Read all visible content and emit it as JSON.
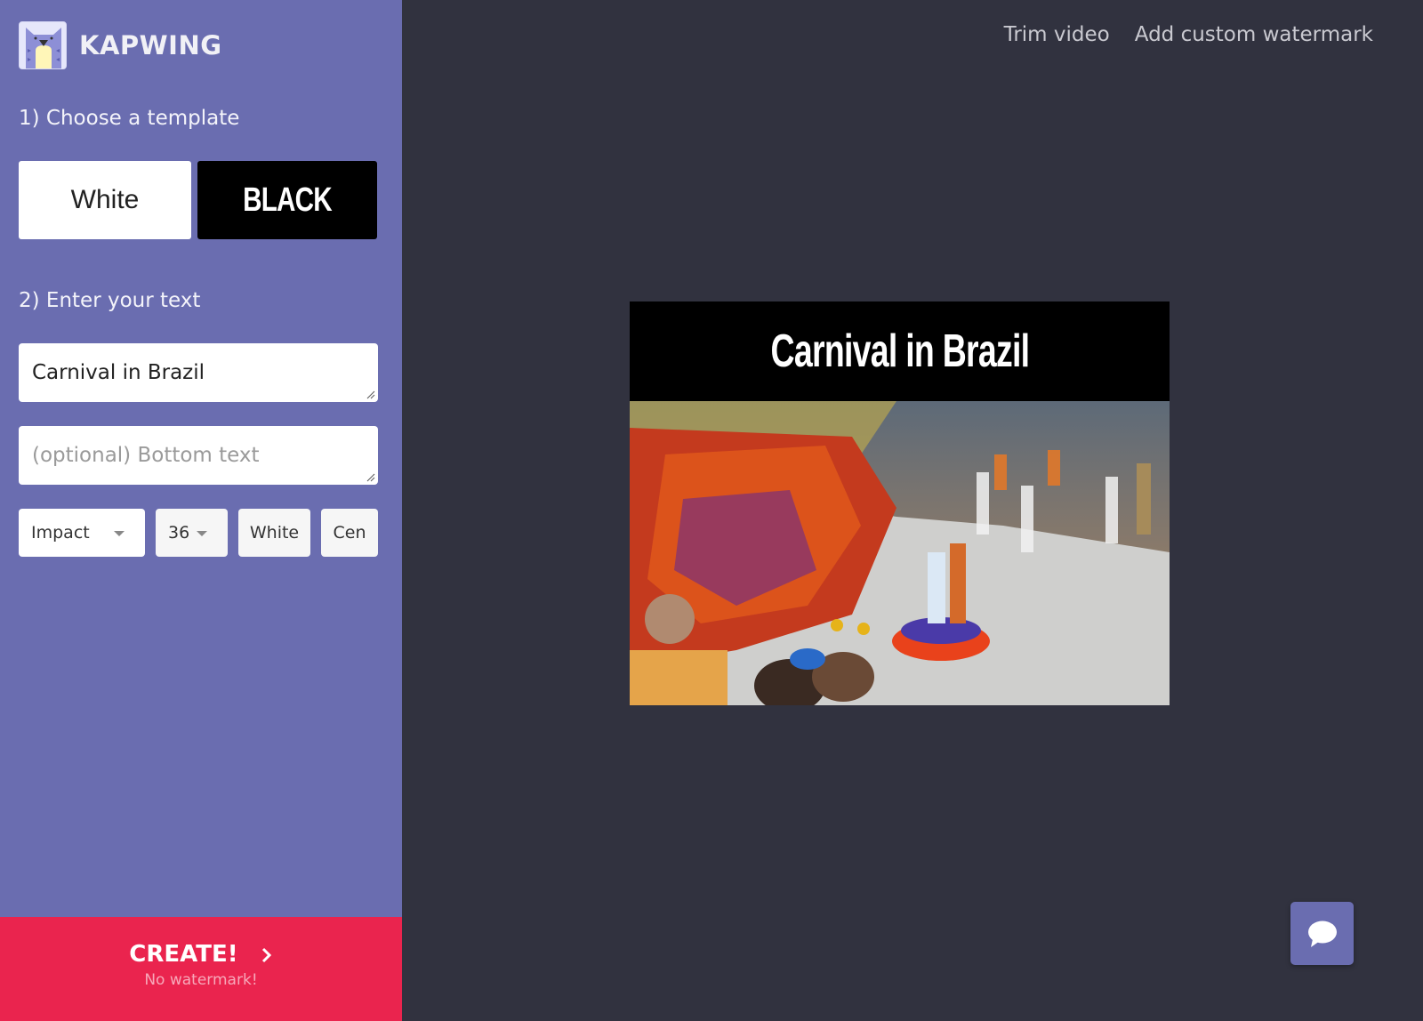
{
  "brand": {
    "name": "KAPWING",
    "logo_icon": "cat-logo-icon"
  },
  "steps": {
    "template_title": "1) Choose a template",
    "text_title": "2) Enter your text"
  },
  "templates": [
    {
      "label": "White",
      "background": "#ffffff",
      "text_color": "#222222"
    },
    {
      "label": "BLACK",
      "background": "#000000",
      "text_color": "#ffffff",
      "selected": true
    }
  ],
  "text_inputs": {
    "top_text": {
      "value": "Carnival in Brazil",
      "placeholder": ""
    },
    "bottom_text": {
      "value": "",
      "placeholder": "(optional) Bottom text"
    }
  },
  "controls": {
    "font": "Impact",
    "size": "36",
    "color": "White",
    "align": "Cen"
  },
  "create_button": {
    "label": "CREATE!",
    "sublabel": "No watermark!",
    "icon": "chevron-right-icon"
  },
  "topnav": [
    {
      "label": "Trim video"
    },
    {
      "label": "Add custom watermark"
    }
  ],
  "preview": {
    "caption": "Carnival in Brazil",
    "image_description": "Carnival parade in Brazil with dancers in red and orange costumes"
  },
  "chat": {
    "icon": "chat-bubble-icon"
  },
  "colors": {
    "sidebar": "#6a6db0",
    "canvas": "#31323f",
    "create": "#ea244e",
    "topnav_text": "#c9c9d0"
  }
}
